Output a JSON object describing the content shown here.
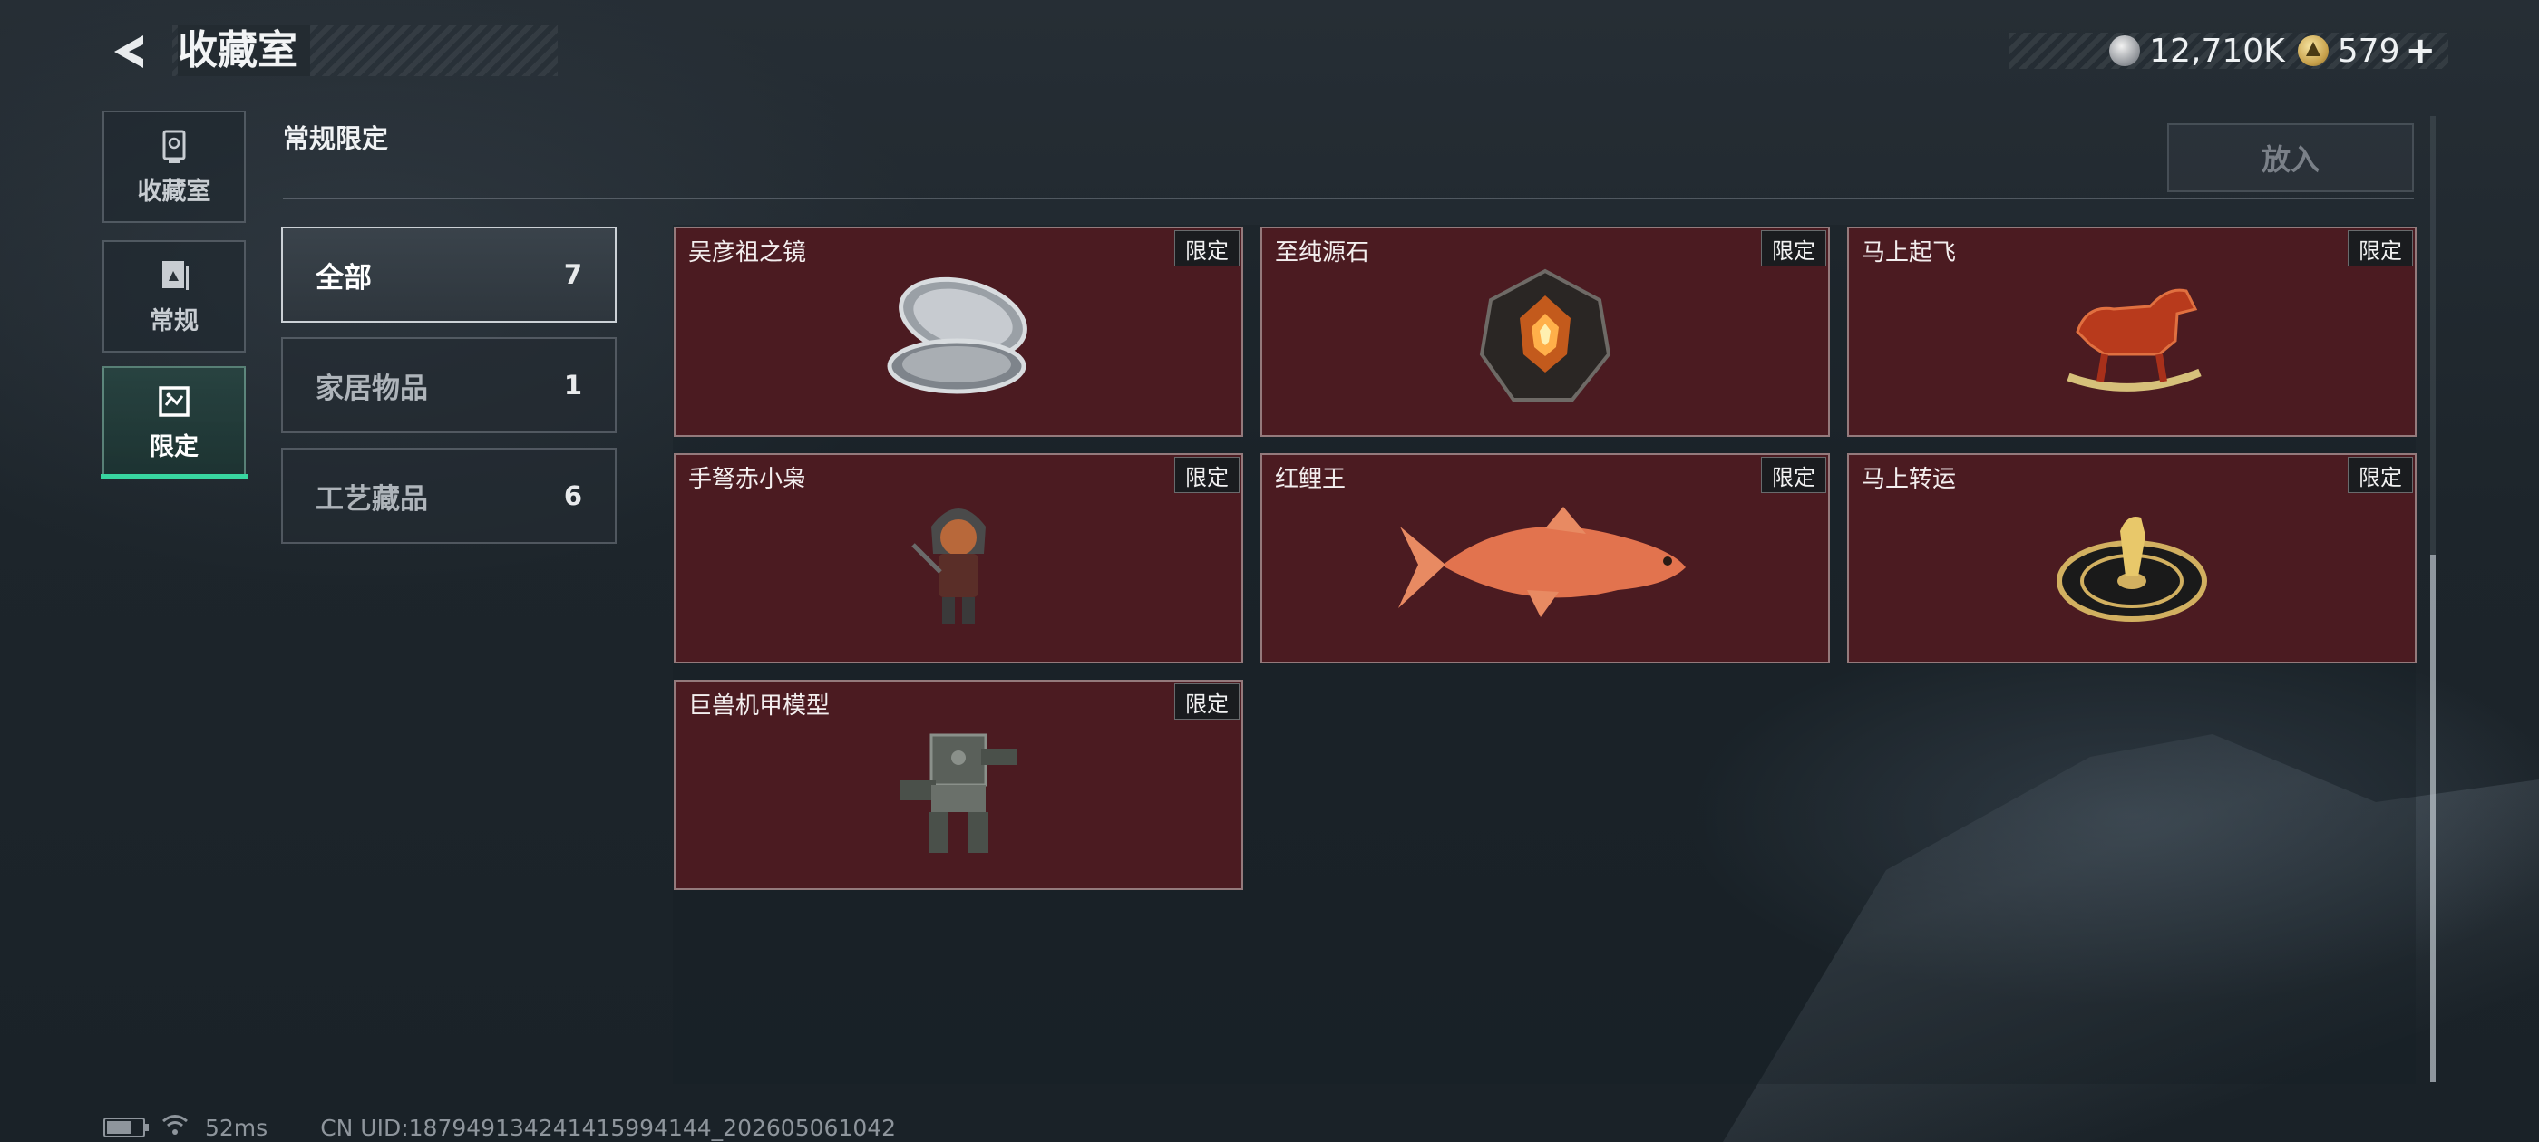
{
  "header": {
    "title": "收藏室",
    "currencies": [
      {
        "icon": "silver-coin-icon",
        "value": "12,710K"
      },
      {
        "icon": "gold-triangle-coin-icon",
        "value": "579"
      }
    ],
    "add_symbol": "+"
  },
  "nav": [
    {
      "label": "收藏室",
      "icon": "trophy-icon"
    },
    {
      "label": "常规",
      "icon": "album-icon"
    },
    {
      "label": "限定",
      "icon": "picture-frame-icon"
    }
  ],
  "section": {
    "title": "常规限定",
    "put_button": "放入"
  },
  "categories": [
    {
      "name": "全部",
      "count": "7"
    },
    {
      "name": "家居物品",
      "count": "1"
    },
    {
      "name": "工艺藏品",
      "count": "6"
    }
  ],
  "items": [
    {
      "name": "吴彦祖之镜",
      "tag": "限定",
      "icon": "compact-mirror-icon"
    },
    {
      "name": "至纯源石",
      "tag": "限定",
      "icon": "glowing-crystal-icon"
    },
    {
      "name": "马上起飞",
      "tag": "限定",
      "icon": "rocking-horse-icon"
    },
    {
      "name": "手弩赤小枭",
      "tag": "限定",
      "icon": "crossbow-figure-icon"
    },
    {
      "name": "红鲤王",
      "tag": "限定",
      "icon": "red-carp-icon"
    },
    {
      "name": "马上转运",
      "tag": "限定",
      "icon": "gold-horse-wheel-icon"
    },
    {
      "name": "巨兽机甲模型",
      "tag": "限定",
      "icon": "mech-model-icon"
    }
  ],
  "status": {
    "ping": "52ms",
    "uid": "CN UID:18794913424141599414​4_202605061042"
  },
  "colors": {
    "accent": "#38d6a0",
    "card": "#4b1b21"
  }
}
